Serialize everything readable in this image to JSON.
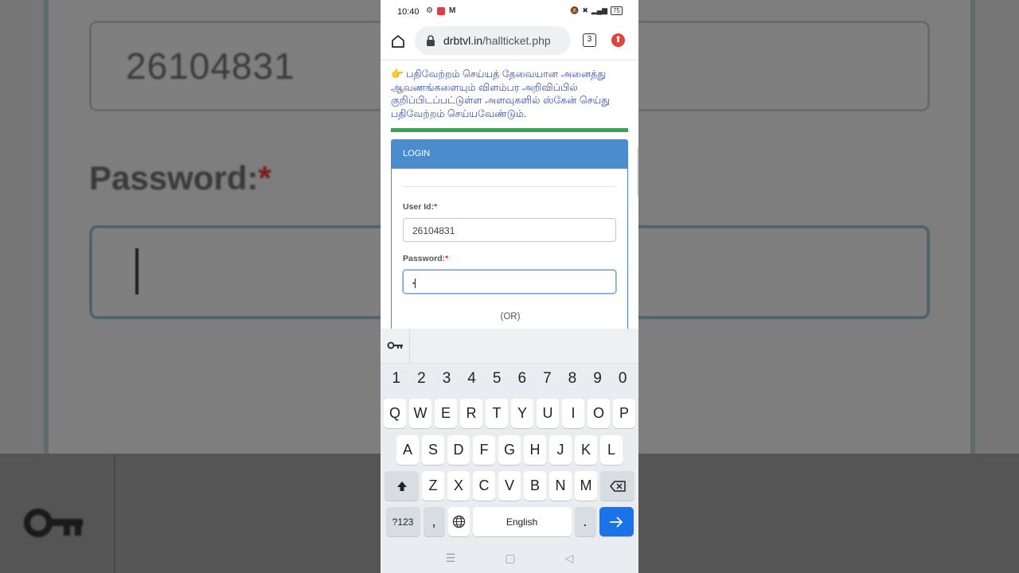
{
  "statusbar": {
    "time": "10:40",
    "battery": "75"
  },
  "browser": {
    "url_domain": "drbtvl.in",
    "url_path": "/hallticket.php",
    "tab_count": "3"
  },
  "page": {
    "notice_icon": "👉",
    "notice_text": "பதிவேற்றம் செய்யத் தேவையான அனைத்து ஆவணங்களையும் விளம்பர அறிவிப்பில் குறிப்பிடப்பட்டுள்ள அளவுகளில் ஸ்கேன் செய்து பதிவேற்றம் செய்யவேண்டும்.",
    "panel_title": "LOGIN",
    "user_id_label": "User Id:",
    "user_id_value": "26104831",
    "password_label": "Password:",
    "password_value": "•",
    "required_mark": "*",
    "or_text": "(OR)"
  },
  "background": {
    "user_id_value": "26104831",
    "password_label": "Password:",
    "required_mark": "*"
  },
  "keyboard": {
    "numbers": [
      "1",
      "2",
      "3",
      "4",
      "5",
      "6",
      "7",
      "8",
      "9",
      "0"
    ],
    "row1": [
      "Q",
      "W",
      "E",
      "R",
      "T",
      "Y",
      "U",
      "I",
      "O",
      "P"
    ],
    "row2": [
      "A",
      "S",
      "D",
      "F",
      "G",
      "H",
      "J",
      "K",
      "L"
    ],
    "row3": [
      "Z",
      "X",
      "C",
      "V",
      "B",
      "N",
      "M"
    ],
    "symbols_label": "?123",
    "comma": ",",
    "space_label": "English",
    "period": "."
  },
  "colors": {
    "panel_header": "#4a8ccc",
    "notice_text": "#3a4fb0",
    "divider_green": "#2fa84f",
    "enter_key": "#1a73e8"
  }
}
